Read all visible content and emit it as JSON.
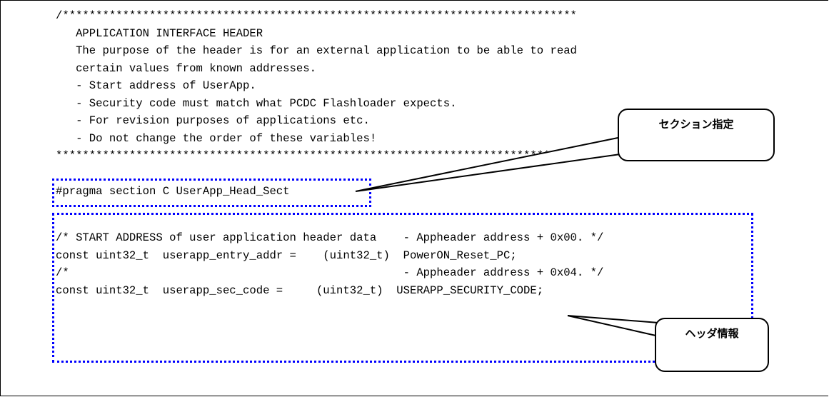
{
  "header_comment": [
    "/*****************************************************************************",
    "   APPLICATION INTERFACE HEADER",
    "   The purpose of the header is for an external application to be able to read",
    "   certain values from known addresses.",
    "   - Start address of UserApp.",
    "   - Security code must match what PCDC Flashloader expects.",
    "   - For revision purposes of applications etc.",
    "   - Do not change the order of these variables!",
    "*****************************************************************************/"
  ],
  "pragma_line": "#pragma section C UserApp_Head_Sect",
  "header_data": [
    "/* START ADDRESS of user application header data    - Appheader address + 0x00. */",
    "const uint32_t  userapp_entry_addr =    (uint32_t)  PowerON_Reset_PC;",
    "",
    "/*                                                  - Appheader address + 0x04. */",
    "const uint32_t  userapp_sec_code =     (uint32_t)  USERAPP_SECURITY_CODE;"
  ],
  "callouts": {
    "section": "セクション指定",
    "header_info": "ヘッダ情報"
  },
  "colors": {
    "highlight_border": "#0000ff",
    "text": "#000000"
  }
}
